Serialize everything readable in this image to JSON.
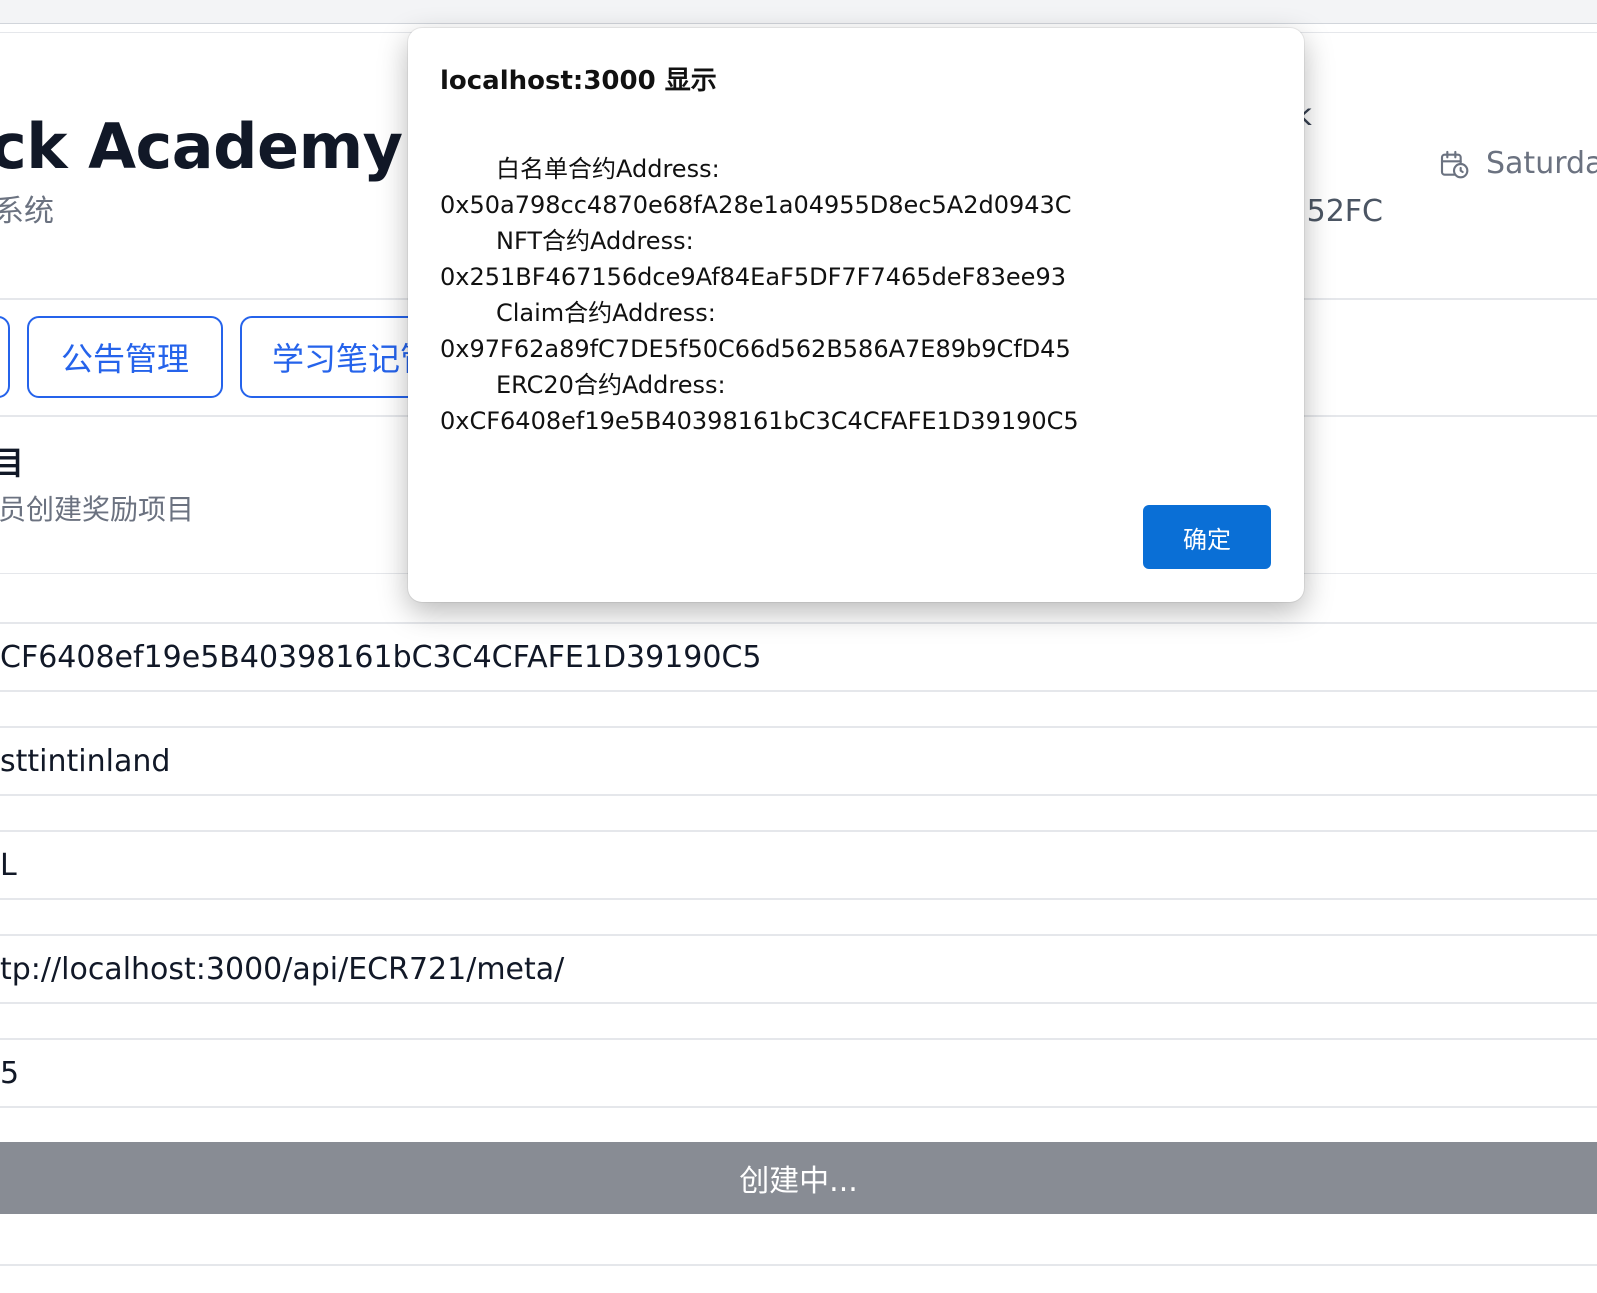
{
  "header": {
    "title": "ck Academy 管",
    "subtitle": "系统",
    "user_name": "ck",
    "wallet_address": "...52FC",
    "date": "Saturday"
  },
  "nav": {
    "announcements_label": "公告管理",
    "notes_label": "学习笔记管"
  },
  "section": {
    "title": "目",
    "description": "学员创建奖励项目"
  },
  "form": {
    "fields": [
      {
        "value": "CF6408ef19e5B40398161bC3C4CFAFE1D39190C5"
      },
      {
        "value": "sttintinland"
      },
      {
        "value": "L"
      },
      {
        "value": "tp://localhost:3000/api/ECR721/meta/"
      },
      {
        "value": "5"
      }
    ],
    "submit_label": "创建中..."
  },
  "dialog": {
    "title": "localhost:3000 显示",
    "lines": [
      {
        "label": "白名单合约Address:",
        "value": "0x50a798cc4870e68fA28e1a04955D8ec5A2d0943C"
      },
      {
        "label": "NFT合约Address:",
        "value": "0x251BF467156dce9Af84EaF5DF7F7465deF83ee93"
      },
      {
        "label": "Claim合约Address:",
        "value": "0x97F62a89fC7DE5f50C66d562B586A7E89b9CfD45"
      },
      {
        "label": "ERC20合约Address:",
        "value": "0xCF6408ef19e5B40398161bC3C4CFAFE1D39190C5"
      }
    ],
    "ok_label": "确定"
  },
  "colors": {
    "accent": "#2563eb",
    "dialog_button": "#0a6fd6",
    "submit_disabled": "#888c94"
  },
  "icons": {
    "calendar": "calendar-icon"
  }
}
